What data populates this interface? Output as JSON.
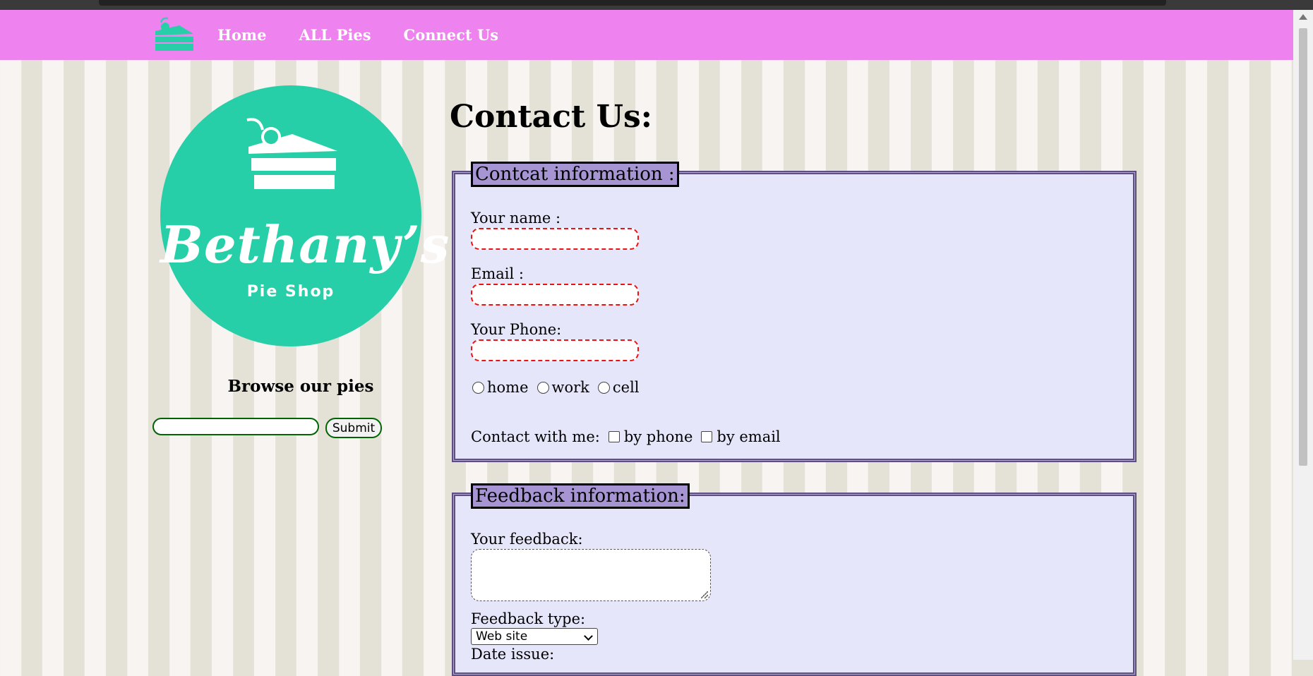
{
  "nav": {
    "links": [
      "Home",
      "ALL Pies",
      "Connect Us"
    ]
  },
  "brand": {
    "title": "Bethany’s",
    "subtitle": "Pie Shop",
    "color": "#26cfa7"
  },
  "sidebar": {
    "browse_title": "Browse our pies",
    "search_value": "",
    "submit_label": "Submit"
  },
  "page": {
    "title": "Contact Us:"
  },
  "contact": {
    "legend": "Contcat information :",
    "name_label": "Your name :",
    "email_label": "Email :",
    "phone_label": "Your Phone:",
    "phone_types": [
      "home",
      "work",
      "cell"
    ],
    "contact_label": "Contact with me:",
    "contact_options": [
      "by phone",
      "by email"
    ]
  },
  "feedback": {
    "legend": "Feedback information:",
    "feedback_label": "Your feedback:",
    "type_label": "Feedback type:",
    "type_selected": "Web site",
    "date_label": "Date issue:"
  },
  "colors": {
    "nav_bg": "#ee82ee",
    "fieldset_bg": "#e6e6fa",
    "legend_bg": "#a694d3",
    "input_border": "#ee1111"
  }
}
